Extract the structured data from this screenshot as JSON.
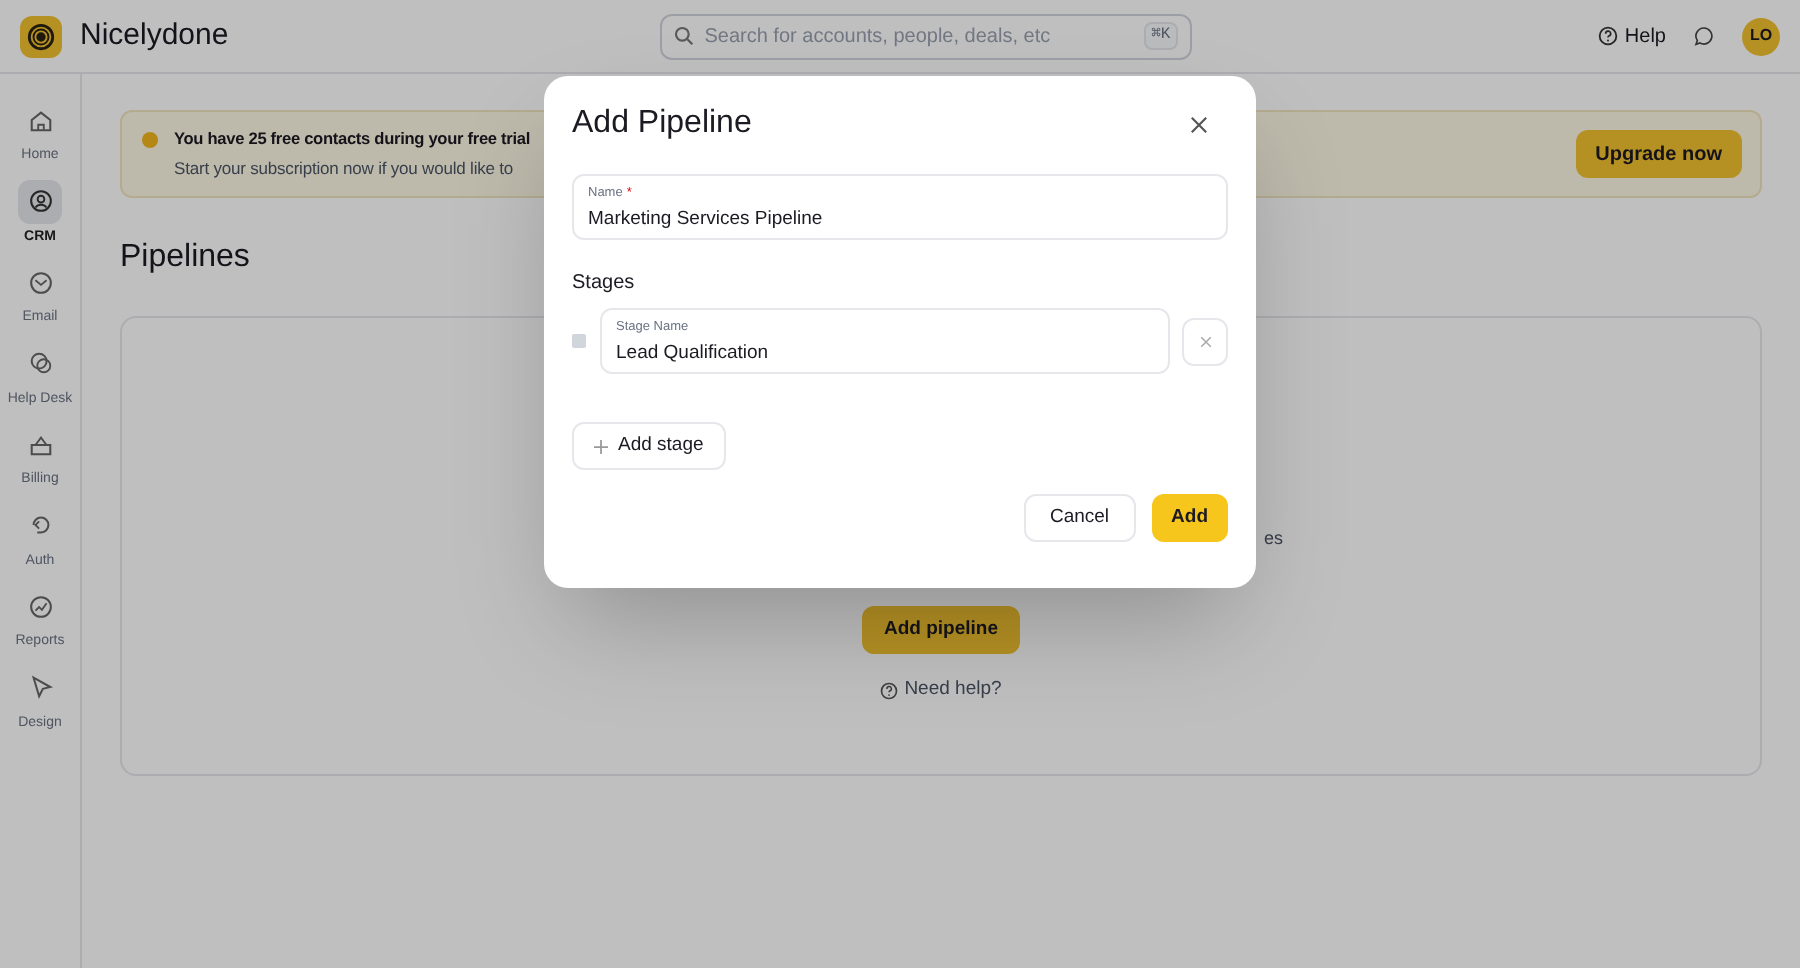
{
  "header": {
    "app_name": "Nicelydone",
    "search": {
      "placeholder": "Search for accounts, people, deals, etc",
      "shortcut": "⌘K"
    },
    "help": "Help",
    "avatar": "LO"
  },
  "sidebar": {
    "items": [
      {
        "kind": "home",
        "label": "Home",
        "selected": false
      },
      {
        "kind": "crm",
        "label": "CRM",
        "selected": true
      },
      {
        "kind": "email",
        "label": "Email",
        "selected": false
      },
      {
        "kind": "helpdesk",
        "label": "Help Desk",
        "selected": false
      },
      {
        "kind": "billing",
        "label": "Billing",
        "selected": false
      },
      {
        "kind": "auth",
        "label": "Auth",
        "selected": false
      },
      {
        "kind": "reports",
        "label": "Reports",
        "selected": false
      },
      {
        "kind": "design",
        "label": "Design",
        "selected": false
      }
    ]
  },
  "banner": {
    "title": "You have 25 free contacts during your free trial",
    "body": "Start your subscription now if you would like to",
    "button": "Upgrade now"
  },
  "page_title": "Pipelines",
  "empty_state": {
    "text_fragment": "es",
    "button": "Add pipeline",
    "help_link": "Need help?"
  },
  "modal": {
    "title": "Add Pipeline",
    "name_field": {
      "label": "Name",
      "required": true,
      "required_mark": "*",
      "value": "Marketing Services Pipeline"
    },
    "stages_label": "Stages",
    "stages": [
      {
        "label": "Stage Name",
        "value": "Lead Qualification"
      }
    ],
    "add_stage": "Add stage",
    "buttons": [
      {
        "kind": "secondary",
        "label": "Cancel"
      },
      {
        "kind": "primary",
        "label": "Add"
      }
    ]
  }
}
